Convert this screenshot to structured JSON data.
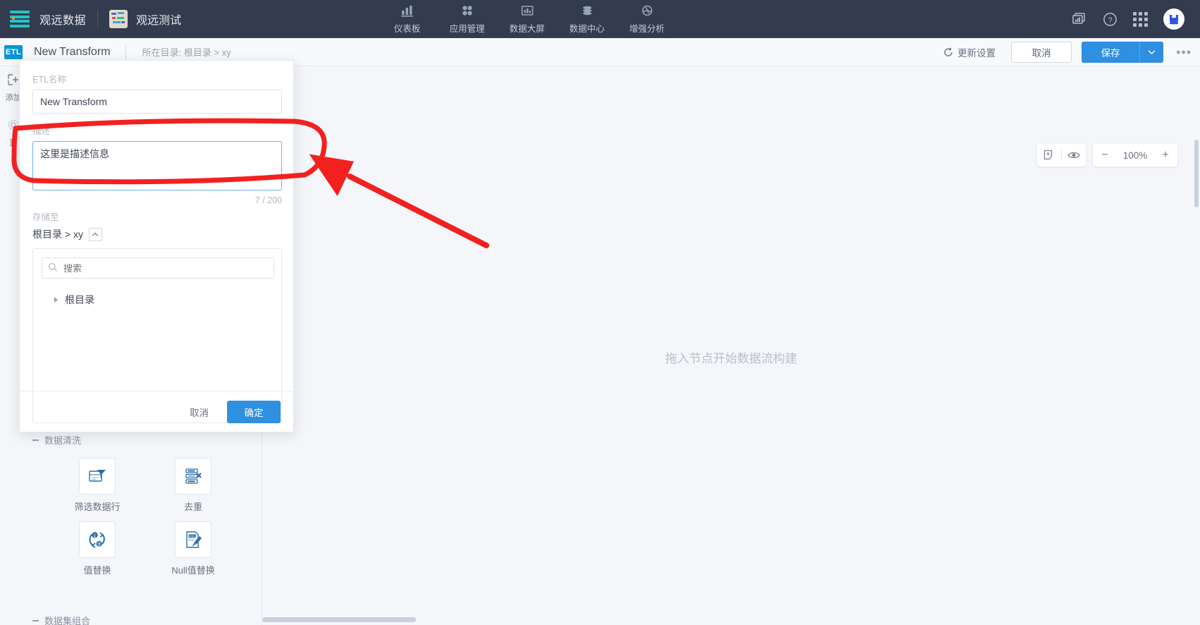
{
  "topnav": {
    "brand": "观远数据",
    "project": "观远测试",
    "menu": [
      {
        "label": "仪表板",
        "icon": "bar-chart-icon"
      },
      {
        "label": "应用管理",
        "icon": "apps-icon"
      },
      {
        "label": "数据大屏",
        "icon": "screen-icon"
      },
      {
        "label": "数据中心",
        "icon": "database-icon"
      },
      {
        "label": "增强分析",
        "icon": "analytics-icon"
      }
    ],
    "right_icons": [
      {
        "name": "reports-icon"
      },
      {
        "name": "help-icon"
      },
      {
        "name": "app-grid-icon"
      },
      {
        "name": "user-avatar"
      }
    ]
  },
  "subbar": {
    "badge": "ETL",
    "title": "New Transform",
    "breadcrumb": "所在目录: 根目录 > xy",
    "refresh_label": "更新设置",
    "cancel_label": "取消",
    "save_label": "保存",
    "more_label": "•••"
  },
  "leftpanel": {
    "tools": [
      {
        "label": "添加",
        "icon": "add-node-icon"
      },
      {
        "label": "置",
        "icon": "settings-icon"
      }
    ],
    "sections": [
      {
        "title": "数据清洗",
        "expanded": true
      },
      {
        "title": "数据集组合",
        "expanded": false
      }
    ],
    "nodes": [
      {
        "label": "筛选数据行",
        "icon": "filter-rows-icon"
      },
      {
        "label": "去重",
        "icon": "dedupe-icon"
      },
      {
        "label": "值替换",
        "icon": "value-replace-icon"
      },
      {
        "label": "Null值替换",
        "icon": "null-replace-icon"
      }
    ]
  },
  "canvas": {
    "hint": "拖入节点开始数据流构建",
    "zoom_level": "100%",
    "tools": [
      {
        "name": "add-note-icon"
      },
      {
        "name": "preview-eye-icon"
      }
    ],
    "zoom_out": "−",
    "zoom_in": "+"
  },
  "dialog": {
    "name_label": "ETL名称",
    "name_value": "New Transform",
    "desc_label": "描述",
    "desc_value": "这里是描述信息",
    "desc_counter": "7 / 200",
    "storage_label": "存储至",
    "storage_path": "根目录 > xy",
    "search_placeholder": "搜索",
    "tree_root": "根目录",
    "cancel_label": "取消",
    "confirm_label": "确定"
  },
  "annotation": {
    "color": "#f32020",
    "shape": "highlight-rectangle-with-arrow",
    "target": "description-textarea"
  },
  "colors": {
    "nav_bg": "#333b4f",
    "accent": "#2f8fe0",
    "brand_teal": "#27c3c3",
    "etl_badge": "#0b96d5",
    "canvas_bg": "#f4f6f9"
  }
}
